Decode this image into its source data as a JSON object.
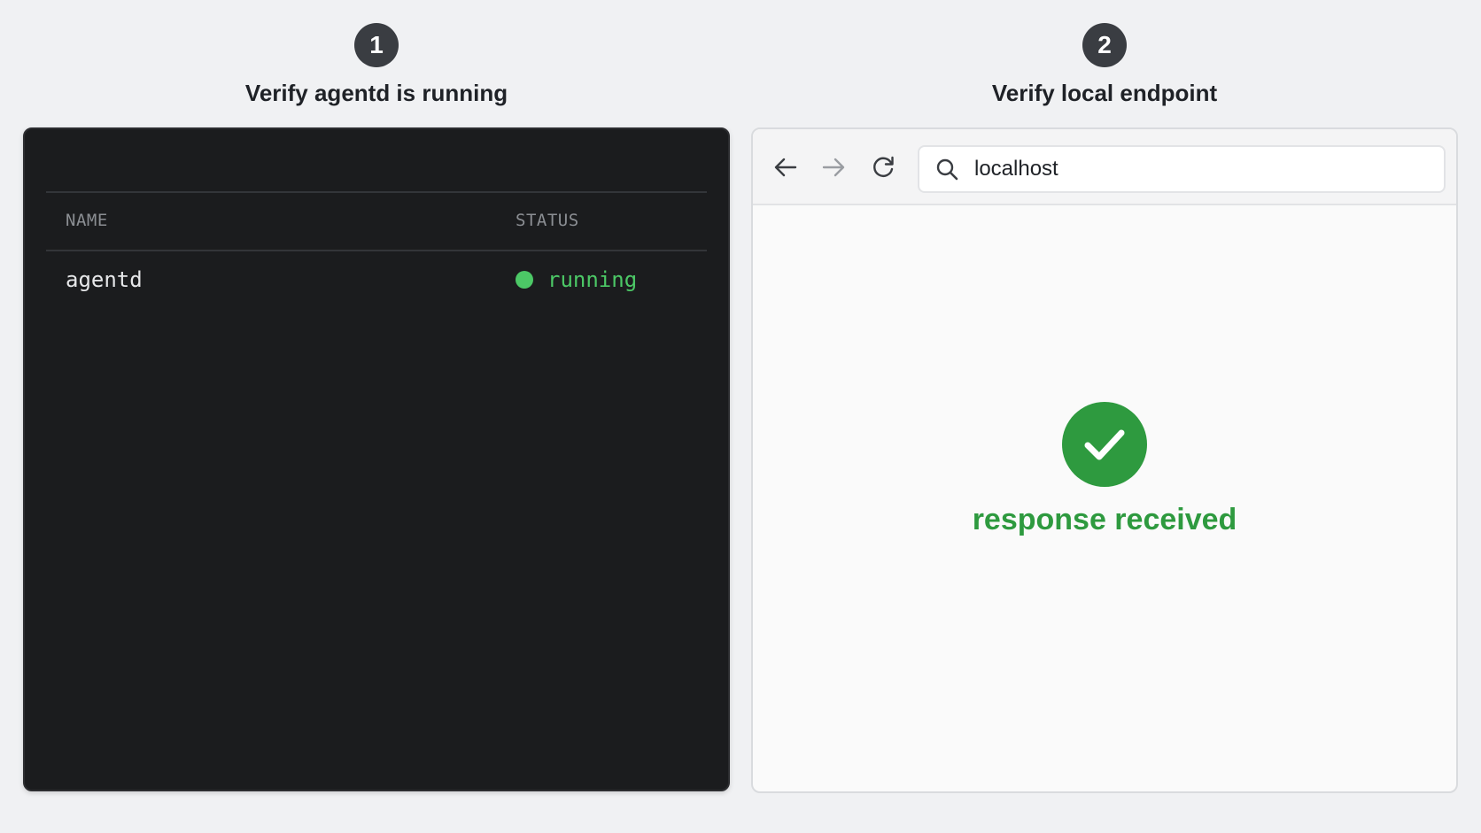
{
  "steps": [
    {
      "number": "1",
      "title": "Verify agentd is running"
    },
    {
      "number": "2",
      "title": "Verify local endpoint"
    }
  ],
  "terminal": {
    "columns": {
      "name": "NAME",
      "status": "STATUS"
    },
    "rows": [
      {
        "name": "agentd",
        "status": "running"
      }
    ]
  },
  "browser": {
    "url": "localhost",
    "response_text": "response received",
    "icons": {
      "back": "arrow-left-icon",
      "forward": "arrow-right-icon",
      "reload": "reload-icon",
      "search": "search-icon",
      "success": "checkmark-circle-icon"
    }
  },
  "colors": {
    "running": "#4cc866",
    "success": "#2e9a3f",
    "terminal_bg": "#1b1c1e",
    "badge_bg": "#3a3d42"
  }
}
